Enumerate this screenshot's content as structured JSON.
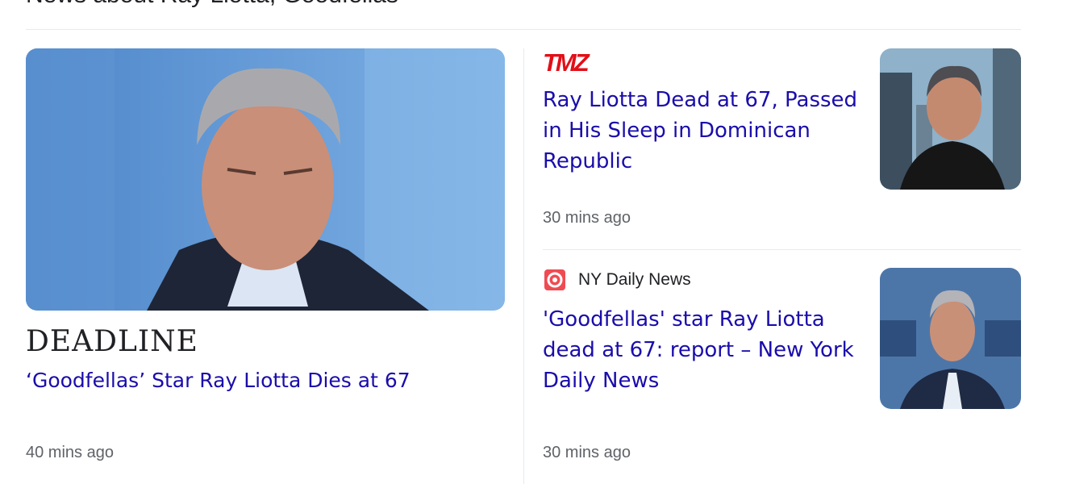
{
  "section": {
    "title": "News about Ray Liotta, Goodfellas"
  },
  "stories": [
    {
      "source": "DEADLINE",
      "headline": "‘Goodfellas’ Star Ray Liotta Dies at 67",
      "time": "40 mins ago",
      "image_icon": "ray-liotta-photo"
    },
    {
      "source": "TMZ",
      "headline": "Ray Liotta Dead at 67, Passed in His Sleep in Dominican Republic",
      "time": "30 mins ago",
      "image_icon": "ray-liotta-photo"
    },
    {
      "source": "NY Daily News",
      "headline": "'Goodfellas' star Ray Liotta dead at 67: report – New York Daily News",
      "time": "30 mins ago",
      "image_icon": "ray-liotta-photo"
    }
  ],
  "colors": {
    "link": "#1a0dab",
    "meta": "#5f6368",
    "tmz_red": "#e20f17",
    "divider": "#e8eaed"
  }
}
